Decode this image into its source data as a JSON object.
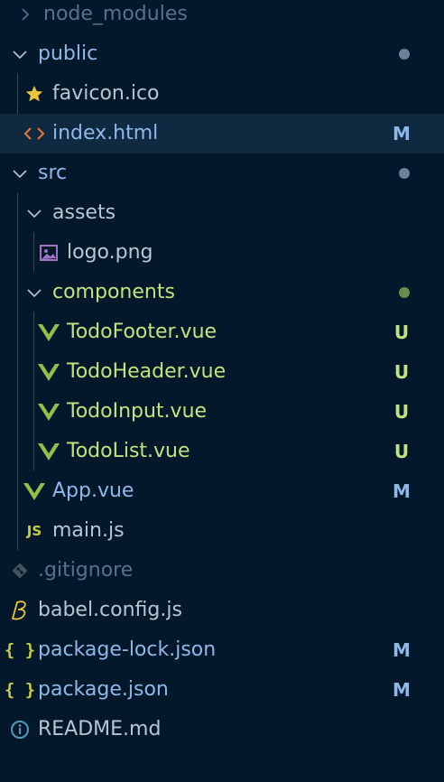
{
  "colors": {
    "background": "#03192b",
    "selected_row": "#0f2a40",
    "modified": "#8fb7e8",
    "untracked": "#c4e27d",
    "ignored": "#5a7186",
    "default": "#b9c5d1",
    "chevron": "#b9c5d1",
    "dot_modified": "#6d8296",
    "dot_untracked": "#6d8c4a"
  },
  "items": [
    {
      "label": "node_modules",
      "icon": "chevron-right-icon",
      "status": ""
    },
    {
      "label": "public",
      "icon": "chevron-down-icon",
      "status": ""
    },
    {
      "label": "favicon.ico",
      "icon": "star-icon",
      "status": ""
    },
    {
      "label": "index.html",
      "icon": "html-code-icon",
      "status": "M"
    },
    {
      "label": "src",
      "icon": "chevron-down-icon",
      "status": ""
    },
    {
      "label": "assets",
      "icon": "chevron-down-icon",
      "status": ""
    },
    {
      "label": "logo.png",
      "icon": "image-icon",
      "status": ""
    },
    {
      "label": "components",
      "icon": "chevron-down-icon",
      "status": ""
    },
    {
      "label": "TodoFooter.vue",
      "icon": "vue-icon",
      "status": "U"
    },
    {
      "label": "TodoHeader.vue",
      "icon": "vue-icon",
      "status": "U"
    },
    {
      "label": "TodoInput.vue",
      "icon": "vue-icon",
      "status": "U"
    },
    {
      "label": "TodoList.vue",
      "icon": "vue-icon",
      "status": "U"
    },
    {
      "label": "App.vue",
      "icon": "vue-icon",
      "status": "M"
    },
    {
      "label": "main.js",
      "icon": "js-icon",
      "icon_text": "JS",
      "status": ""
    },
    {
      "label": ".gitignore",
      "icon": "git-icon",
      "status": ""
    },
    {
      "label": "babel.config.js",
      "icon": "babel-icon",
      "status": ""
    },
    {
      "label": "package-lock.json",
      "icon": "json-icon",
      "icon_text": "{ }",
      "status": "M"
    },
    {
      "label": "package.json",
      "icon": "json-icon",
      "icon_text": "{ }",
      "status": "M"
    },
    {
      "label": "README.md",
      "icon": "info-icon",
      "status": ""
    }
  ]
}
